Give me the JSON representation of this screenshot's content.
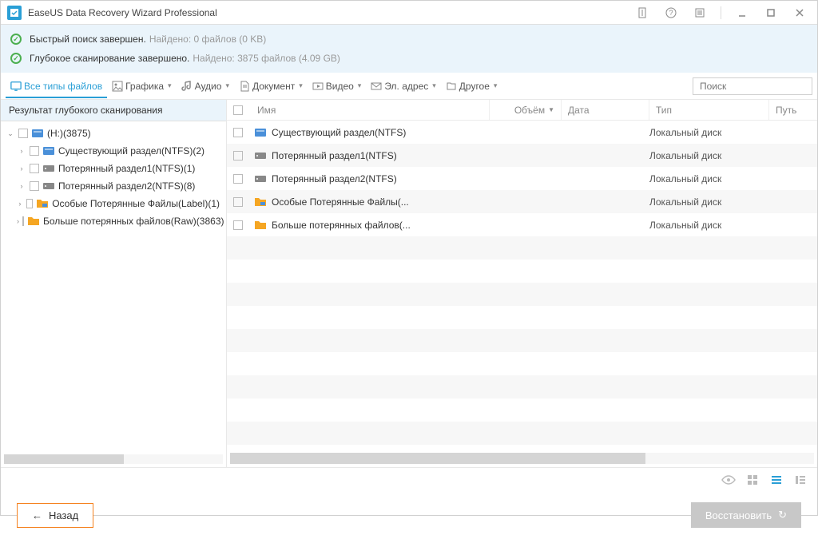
{
  "titlebar": {
    "title": "EaseUS Data Recovery Wizard Professional"
  },
  "status": {
    "quick": {
      "label": "Быстрый поиск завершен.",
      "detail": "Найдено: 0 файлов (0 KB)"
    },
    "deep": {
      "label": "Глубокое сканирование завершено.",
      "detail": "Найдено: 3875 файлов (4.09 GB)"
    }
  },
  "toolbar": {
    "all": "Все типы файлов",
    "graphics": "Графика",
    "audio": "Аудио",
    "document": "Документ",
    "video": "Видео",
    "email": "Эл. адрес",
    "other": "Другое",
    "search_placeholder": "Поиск"
  },
  "tree": {
    "header": "Результат глубокого сканирования",
    "root": "(H:)(3875)",
    "items": [
      {
        "label": "Существующий раздел(NTFS)(2)"
      },
      {
        "label": "Потерянный раздел1(NTFS)(1)"
      },
      {
        "label": "Потерянный раздел2(NTFS)(8)"
      },
      {
        "label": "Особые Потерянные Файлы(Label)(1)"
      },
      {
        "label": "Больше потерянных файлов(Raw)(3863)"
      }
    ]
  },
  "table": {
    "headers": {
      "name": "Имя",
      "volume": "Объём",
      "date": "Дата",
      "type": "Тип",
      "path": "Путь"
    },
    "rows": [
      {
        "name": "Существующий раздел(NTFS)",
        "type": "Локальный диск",
        "icon": "disk"
      },
      {
        "name": "Потерянный раздел1(NTFS)",
        "type": "Локальный диск",
        "icon": "hdd"
      },
      {
        "name": "Потерянный раздел2(NTFS)",
        "type": "Локальный диск",
        "icon": "hdd"
      },
      {
        "name": "Особые Потерянные Файлы(...",
        "type": "Локальный диск",
        "icon": "folder-blue"
      },
      {
        "name": "Больше потерянных файлов(...",
        "type": "Локальный диск",
        "icon": "folder"
      }
    ]
  },
  "footer": {
    "back": "Назад",
    "recover": "Восстановить"
  }
}
